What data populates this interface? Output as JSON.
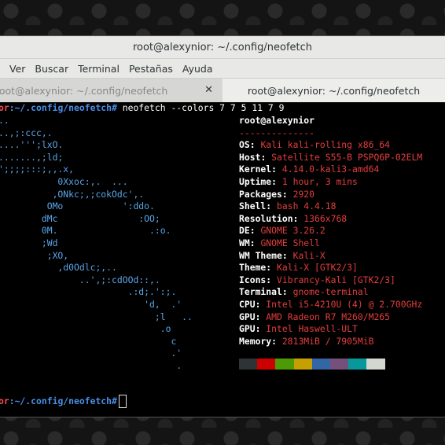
{
  "window": {
    "title": "root@alexynior: ~/.config/neofetch"
  },
  "menu": [
    "Ver",
    "Buscar",
    "Terminal",
    "Pestañas",
    "Ayuda"
  ],
  "tabs": [
    {
      "label": "root@alexynior: ~/.config/neofetch",
      "active": false
    },
    {
      "label": "root@alexynior: ~/.config/neofetch",
      "active": true
    }
  ],
  "terminal": {
    "prompt_user": "or",
    "prompt_path": ":~/.config/neofetch#",
    "command": " neofetch --colors 7 7 5 11 7 9",
    "second_prompt_user": "or",
    "second_prompt_path": ":~/.config/neofetch#",
    "art": [
      "..",
      "..,;:ccc,.",
      "....''';lxO.",
      ".......,;ld;",
      "';;;;:::;,,.x,",
      "           0Xxoc:,.  ...",
      "          ,ONkc;,;cokOdc',.",
      "         OMo           ':ddo.",
      "        dMc               :OO;",
      "        0M.                 .:o.",
      "        ;Wd",
      "         ;XO,",
      "           ,d0Odlc;,..",
      "               ..',;:cdOOd::,.",
      "                        .:d;.':;.",
      "                           'd,  .'",
      "                             ;l   ..",
      "                              .o",
      "                                c",
      "                                .'",
      "                                 ."
    ],
    "user_host": "root@alexynior",
    "separator": "--------------",
    "info": [
      {
        "key": "OS",
        "value": "Kali kali-rolling x86_64"
      },
      {
        "key": "Host",
        "value": "Satellite S55-B PSPQ6P-02ELM"
      },
      {
        "key": "Kernel",
        "value": "4.14.0-kali3-amd64"
      },
      {
        "key": "Uptime",
        "value": "1 hour, 3 mins"
      },
      {
        "key": "Packages",
        "value": "2920"
      },
      {
        "key": "Shell",
        "value": "bash 4.4.18"
      },
      {
        "key": "Resolution",
        "value": "1366x768"
      },
      {
        "key": "DE",
        "value": "GNOME 3.26.2"
      },
      {
        "key": "WM",
        "value": "GNOME Shell"
      },
      {
        "key": "WM Theme",
        "value": "Kali-X"
      },
      {
        "key": "Theme",
        "value": "Kali-X [GTK2/3]"
      },
      {
        "key": "Icons",
        "value": "Vibrancy-Kali [GTK2/3]"
      },
      {
        "key": "Terminal",
        "value": "gnome-terminal"
      },
      {
        "key": "CPU",
        "value": "Intel i5-4210U (4) @ 2.700GHz"
      },
      {
        "key": "GPU",
        "value": "AMD Radeon R7 M260/M265"
      },
      {
        "key": "GPU",
        "value": "Intel Haswell-ULT"
      },
      {
        "key": "Memory",
        "value": "2813MiB / 7905MiB"
      }
    ],
    "color_blocks": [
      "#2e3436",
      "#cc0000",
      "#4e9a06",
      "#c4a000",
      "#3465a4",
      "#75507b",
      "#06989a",
      "#d3d7cf"
    ]
  }
}
